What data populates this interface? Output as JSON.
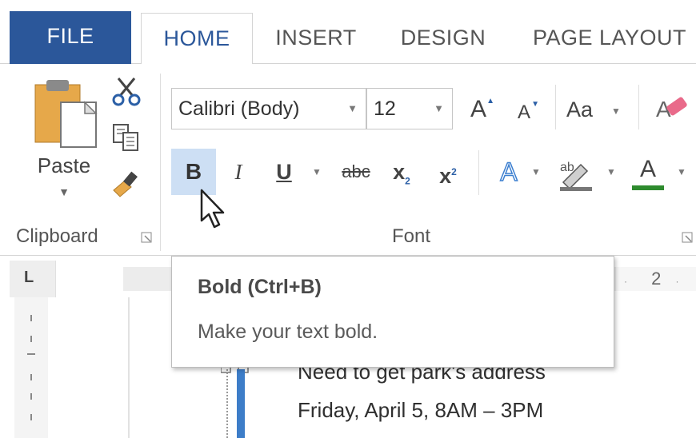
{
  "tabs": {
    "file": "FILE",
    "home": "HOME",
    "insert": "INSERT",
    "design": "DESIGN",
    "page_layout": "PAGE LAYOUT"
  },
  "clipboard": {
    "paste_label": "Paste",
    "group_label": "Clipboard"
  },
  "font": {
    "group_label": "Font",
    "font_name": "Calibri (Body)",
    "font_size": "12",
    "grow_label": "A",
    "shrink_label": "A",
    "change_case_label": "Aa",
    "bold_label": "B",
    "italic_label": "I",
    "underline_label": "U",
    "strikethrough_label": "abc",
    "subscript_label": "x",
    "subscript_sub": "2",
    "superscript_label": "x",
    "superscript_sup": "2",
    "text_effects_label": "A",
    "highlight_label": "ab",
    "font_color_label": "A"
  },
  "ruler": {
    "tab_marker": "L",
    "mark_2": "2"
  },
  "tooltip": {
    "title": "Bold (Ctrl+B)",
    "description": "Make your text bold."
  },
  "document": {
    "line1": "Need to get park's address",
    "line2": "Friday,  April 5, 8AM – 3PM"
  },
  "colors": {
    "file_tab": "#2b579a",
    "accent": "#2b579a",
    "bold_hover": "#cddff4",
    "font_color_bar": "#2e8b2e",
    "text_effects": "#3c7fd0"
  }
}
